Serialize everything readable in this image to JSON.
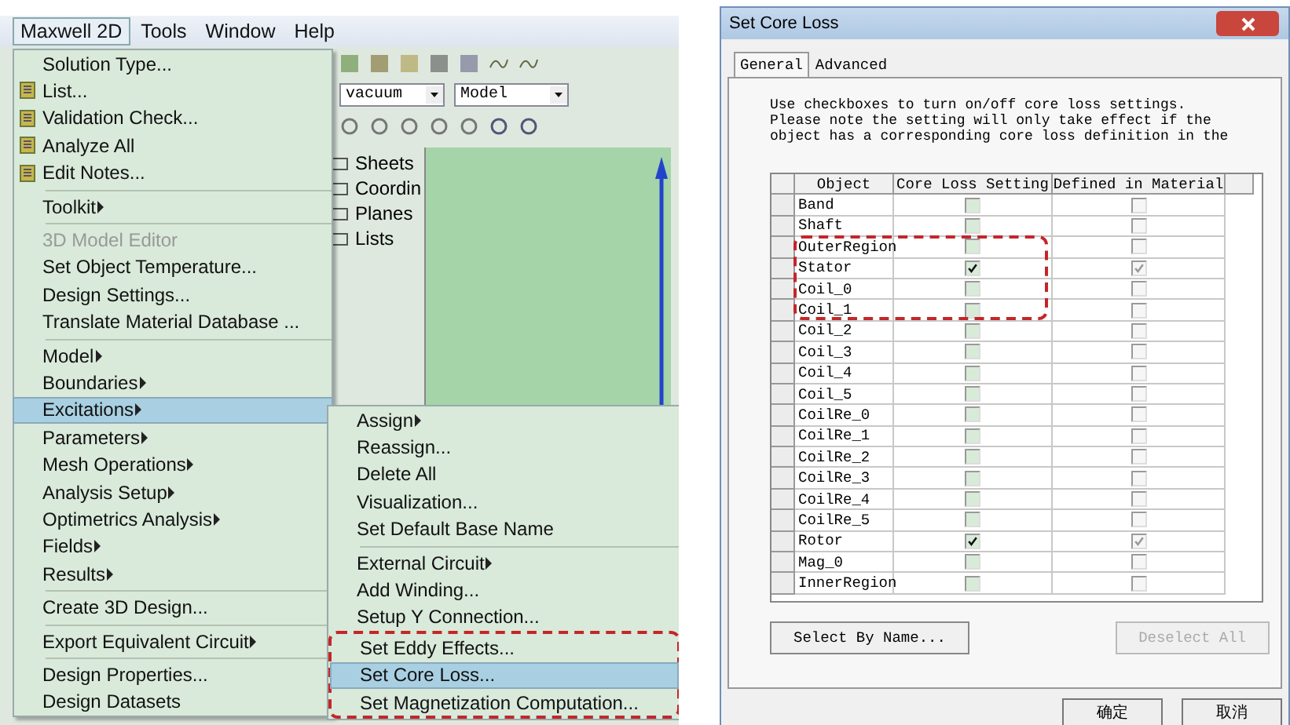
{
  "menu_bar": [
    {
      "label": "Maxwell 2D",
      "selected": true
    },
    {
      "label": "Tools",
      "selected": false
    },
    {
      "label": "Window",
      "selected": false
    },
    {
      "label": "Help",
      "selected": false
    }
  ],
  "toolbar": {
    "material": "vacuum",
    "view": "Model"
  },
  "tree": [
    "Sheets",
    "Coordin",
    "Planes",
    "Lists"
  ],
  "menu": {
    "groups": [
      [
        {
          "label": "Solution Type...",
          "icon": false,
          "submenu": false,
          "disabled": false,
          "selected": false
        },
        {
          "label": "List...",
          "icon": true,
          "submenu": false,
          "disabled": false,
          "selected": false
        },
        {
          "label": "Validation Check...",
          "icon": true,
          "submenu": false,
          "disabled": false,
          "selected": false
        },
        {
          "label": "Analyze All",
          "icon": true,
          "submenu": false,
          "disabled": false,
          "selected": false
        },
        {
          "label": "Edit Notes...",
          "icon": true,
          "submenu": false,
          "disabled": false,
          "selected": false
        }
      ],
      [
        {
          "label": "Toolkit",
          "icon": false,
          "submenu": true,
          "disabled": false,
          "selected": false
        }
      ],
      [
        {
          "label": "3D Model Editor",
          "icon": false,
          "submenu": false,
          "disabled": true,
          "selected": false
        },
        {
          "label": "Set Object Temperature...",
          "icon": false,
          "submenu": false,
          "disabled": false,
          "selected": false
        },
        {
          "label": "Design Settings...",
          "icon": false,
          "submenu": false,
          "disabled": false,
          "selected": false
        },
        {
          "label": "Translate Material Database ...",
          "icon": false,
          "submenu": false,
          "disabled": false,
          "selected": false
        }
      ],
      [
        {
          "label": "Model",
          "icon": false,
          "submenu": true,
          "disabled": false,
          "selected": false
        },
        {
          "label": "Boundaries",
          "icon": false,
          "submenu": true,
          "disabled": false,
          "selected": false
        },
        {
          "label": "Excitations",
          "icon": false,
          "submenu": true,
          "disabled": false,
          "selected": true
        },
        {
          "label": "Parameters",
          "icon": false,
          "submenu": true,
          "disabled": false,
          "selected": false
        },
        {
          "label": "Mesh Operations",
          "icon": false,
          "submenu": true,
          "disabled": false,
          "selected": false
        },
        {
          "label": "Analysis Setup",
          "icon": false,
          "submenu": true,
          "disabled": false,
          "selected": false
        },
        {
          "label": "Optimetrics Analysis",
          "icon": false,
          "submenu": true,
          "disabled": false,
          "selected": false
        },
        {
          "label": "Fields",
          "icon": false,
          "submenu": true,
          "disabled": false,
          "selected": false
        },
        {
          "label": "Results",
          "icon": false,
          "submenu": true,
          "disabled": false,
          "selected": false
        }
      ],
      [
        {
          "label": "Create 3D Design...",
          "icon": false,
          "submenu": false,
          "disabled": false,
          "selected": false
        }
      ],
      [
        {
          "label": "Export Equivalent Circuit",
          "icon": false,
          "submenu": true,
          "disabled": false,
          "selected": false
        }
      ],
      [
        {
          "label": "Design Properties...",
          "icon": false,
          "submenu": false,
          "disabled": false,
          "selected": false
        },
        {
          "label": "Design Datasets",
          "icon": false,
          "submenu": false,
          "disabled": false,
          "selected": false
        }
      ]
    ]
  },
  "submenu": {
    "groups": [
      [
        {
          "label": "Assign",
          "submenu": true,
          "selected": false,
          "annotated": false
        },
        {
          "label": "Reassign...",
          "submenu": false,
          "selected": false,
          "annotated": false
        },
        {
          "label": "Delete All",
          "submenu": false,
          "selected": false,
          "annotated": false
        },
        {
          "label": "Visualization...",
          "submenu": false,
          "selected": false,
          "annotated": false
        },
        {
          "label": "Set Default Base Name",
          "submenu": false,
          "selected": false,
          "annotated": false
        }
      ],
      [
        {
          "label": "External Circuit",
          "submenu": true,
          "selected": false,
          "annotated": false
        },
        {
          "label": "Add Winding...",
          "submenu": false,
          "selected": false,
          "annotated": false
        },
        {
          "label": "Setup Y Connection...",
          "submenu": false,
          "selected": false,
          "annotated": false
        },
        {
          "label": "Set Eddy Effects...",
          "submenu": false,
          "selected": false,
          "annotated": true
        },
        {
          "label": "Set Core Loss...",
          "submenu": false,
          "selected": true,
          "annotated": true
        },
        {
          "label": "Set Magnetization Computation...",
          "submenu": false,
          "selected": false,
          "annotated": true
        }
      ]
    ]
  },
  "dialog": {
    "title": "Set Core Loss",
    "tabs": [
      {
        "label": "General",
        "selected": true
      },
      {
        "label": "Advanced",
        "selected": false
      }
    ],
    "description": [
      "Use checkboxes to turn on/off core loss settings.",
      "Please note the setting will only take effect if the",
      "object has a corresponding core loss definition in the"
    ],
    "table": {
      "columns": [
        "Object",
        "Core Loss Setting",
        "Defined in Material"
      ],
      "rows": [
        {
          "object": "Band",
          "core_loss": false,
          "defined": false,
          "annotated": false
        },
        {
          "object": "Shaft",
          "core_loss": false,
          "defined": false,
          "annotated": false
        },
        {
          "object": "OuterRegion",
          "core_loss": false,
          "defined": false,
          "annotated": true
        },
        {
          "object": "Stator",
          "core_loss": true,
          "defined": true,
          "annotated": true
        },
        {
          "object": "Coil_0",
          "core_loss": false,
          "defined": false,
          "annotated": true
        },
        {
          "object": "Coil_1",
          "core_loss": false,
          "defined": false,
          "annotated": true
        },
        {
          "object": "Coil_2",
          "core_loss": false,
          "defined": false,
          "annotated": false
        },
        {
          "object": "Coil_3",
          "core_loss": false,
          "defined": false,
          "annotated": false
        },
        {
          "object": "Coil_4",
          "core_loss": false,
          "defined": false,
          "annotated": false
        },
        {
          "object": "Coil_5",
          "core_loss": false,
          "defined": false,
          "annotated": false
        },
        {
          "object": "CoilRe_0",
          "core_loss": false,
          "defined": false,
          "annotated": false
        },
        {
          "object": "CoilRe_1",
          "core_loss": false,
          "defined": false,
          "annotated": false
        },
        {
          "object": "CoilRe_2",
          "core_loss": false,
          "defined": false,
          "annotated": false
        },
        {
          "object": "CoilRe_3",
          "core_loss": false,
          "defined": false,
          "annotated": false
        },
        {
          "object": "CoilRe_4",
          "core_loss": false,
          "defined": false,
          "annotated": false
        },
        {
          "object": "CoilRe_5",
          "core_loss": false,
          "defined": false,
          "annotated": false
        },
        {
          "object": "Rotor",
          "core_loss": true,
          "defined": true,
          "annotated": false
        },
        {
          "object": "Mag_0",
          "core_loss": false,
          "defined": false,
          "annotated": false
        },
        {
          "object": "InnerRegion",
          "core_loss": false,
          "defined": false,
          "annotated": false
        }
      ]
    },
    "select_button": "Select By Name...",
    "deselect_button": "Deselect All",
    "buttons": [
      "确定",
      "取消"
    ]
  }
}
